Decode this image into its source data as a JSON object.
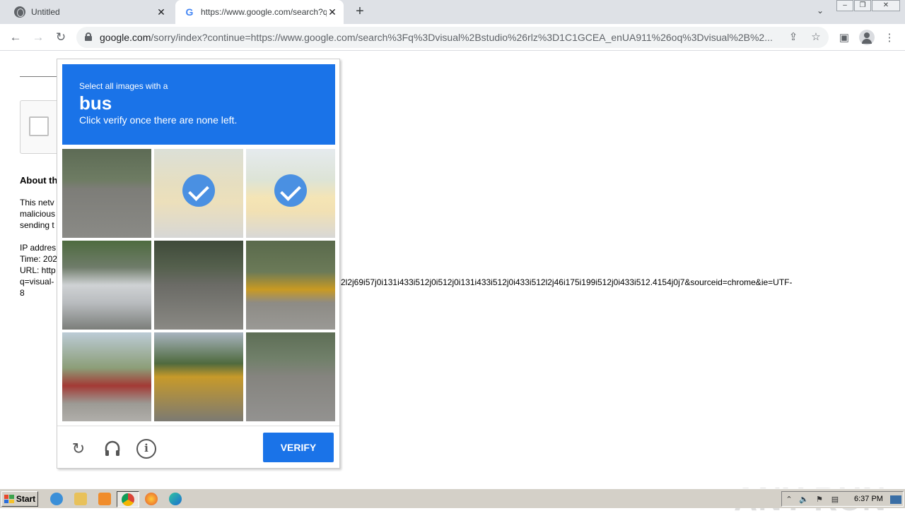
{
  "browser": {
    "tabs": [
      {
        "title": "Untitled",
        "active": false
      },
      {
        "title": "https://www.google.com/search?q=",
        "active": true
      }
    ],
    "new_tab_label": "+",
    "address": {
      "host": "google.com",
      "path": "/sorry/index?continue=https://www.google.com/search%3Fq%3Dvisual%2Bstudio%26rlz%3D1C1GCEA_enUA911%26oq%3Dvisual%2B%2..."
    }
  },
  "page": {
    "about_title": "About th",
    "lines": [
      "This netv",
      "malicious",
      "sending t",
      "IP addres",
      "Time: 202",
      "URL: http",
      "q=visual-",
      "8"
    ],
    "url_tail": "2l2j69i57j0i131i433i512j0i512j0i131i433i512j0i433i512l2j46i175i199i512j0i433i512.4154j0j7&sourceid=chrome&ie=UTF-"
  },
  "challenge": {
    "select_text": "Select all images with a",
    "target": "bus",
    "instruction": "Click verify once there are none left.",
    "tiles": [
      {
        "scene": "road-trees",
        "selected": false
      },
      {
        "scene": "school-bus-rear",
        "selected": true
      },
      {
        "scene": "school-bus-street",
        "selected": true
      },
      {
        "scene": "white-car",
        "selected": false
      },
      {
        "scene": "underpass-road",
        "selected": false
      },
      {
        "scene": "bus-crosswalk",
        "selected": false
      },
      {
        "scene": "palms-traffic-light",
        "selected": false
      },
      {
        "scene": "traffic-light-sign",
        "selected": false
      },
      {
        "scene": "empty-road",
        "selected": false
      }
    ],
    "verify_label": "VERIFY"
  },
  "watermark": "ANY RUN",
  "taskbar": {
    "start_label": "Start",
    "clock": "6:37 PM"
  },
  "colors": {
    "accent": "#1a73e8",
    "check": "#4a90e2"
  }
}
